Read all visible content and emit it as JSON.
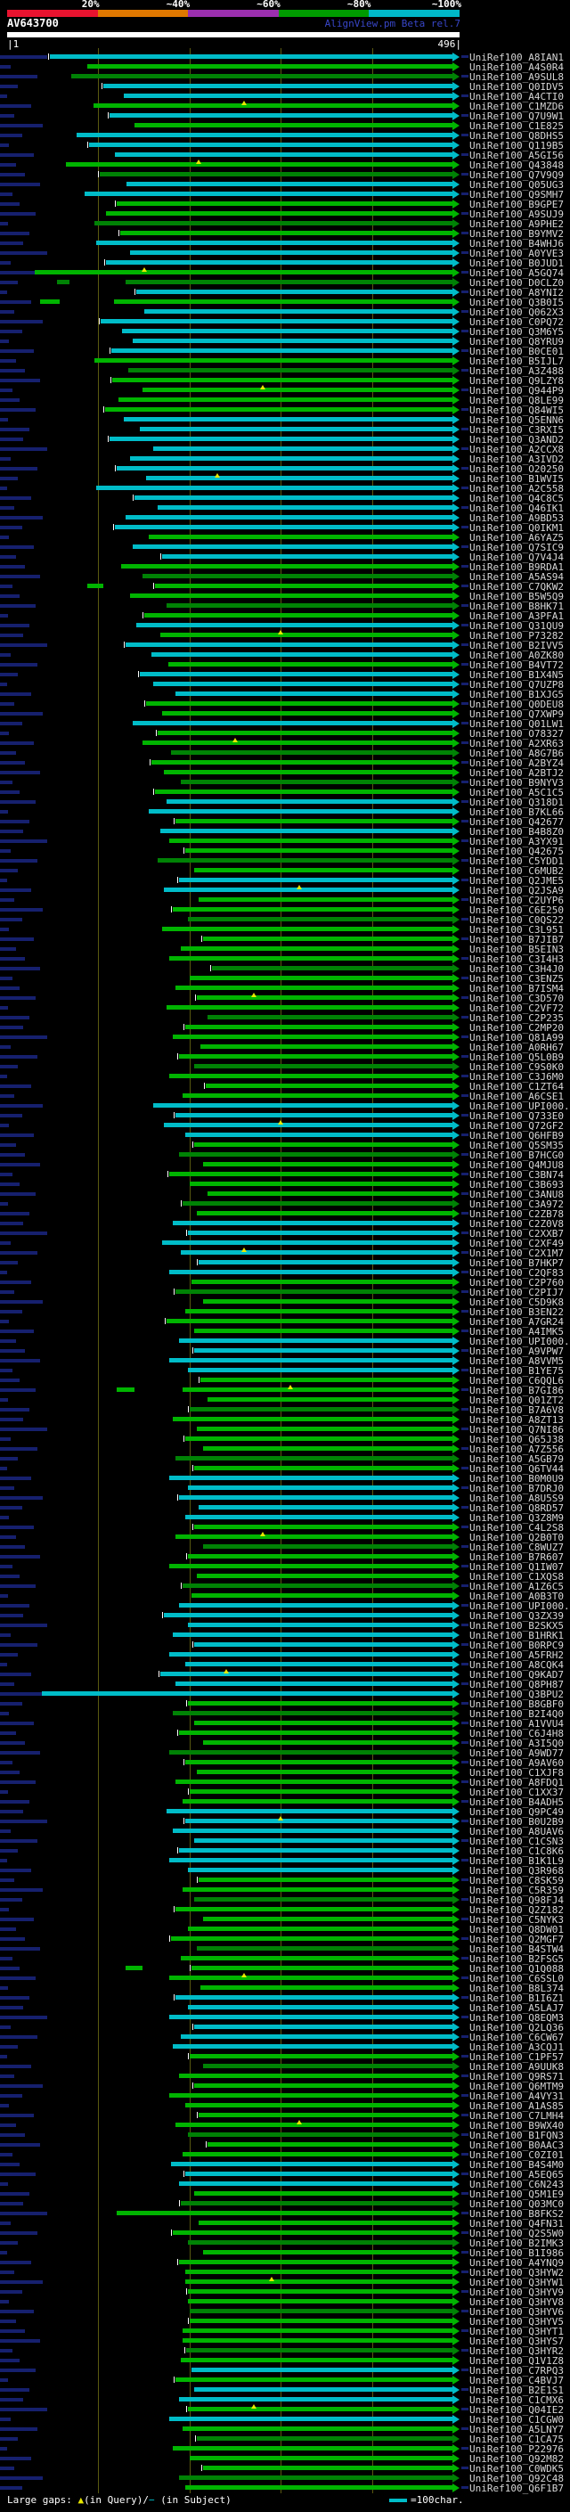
{
  "header": {
    "scale_labels": [
      "20%",
      "~40%",
      "~60%",
      "~80%",
      "~100%"
    ],
    "scale_colors": [
      "#e8132f",
      "#e07800",
      "#9b2fae",
      "#009c00",
      "#00b7c8"
    ],
    "query_id": "AV643700",
    "app_name": "AlignView.pm Beta rel.7",
    "ruler_start_label": "|1",
    "ruler_end_label": "496|",
    "query_length": 496,
    "tick_positions": [
      100,
      200,
      300,
      400
    ]
  },
  "footer": {
    "label": "Large gaps: ",
    "tri_glyph": "▲",
    "query_text": "(in Query)/",
    "dash_glyph": "−",
    "subject_text": " (in Subject)",
    "scale_note": "=100char."
  },
  "bar_colors": {
    "c": "#00bcc8",
    "g": "#00b400",
    "d": "#008205",
    "navy": "#16206e"
  },
  "label_prefix": "UniRef100_",
  "decor": {
    "lead_pattern": [
      53,
      12,
      42,
      20,
      8,
      35,
      16,
      48,
      25,
      10,
      38,
      18,
      28,
      45,
      14,
      22,
      40,
      9,
      33,
      26
    ],
    "stub_every": 2,
    "tick_every": 3
  },
  "rows": [
    [
      "A8IAN1",
      "c",
      47,
      0,
      0
    ],
    [
      "A4S0R4",
      "g",
      88,
      0,
      0
    ],
    [
      "A9SUL8",
      "d",
      70,
      0,
      0
    ],
    [
      "Q0IDV5",
      "c",
      105,
      0,
      0
    ],
    [
      "A4CTI0",
      "c",
      128,
      0,
      0
    ],
    [
      "C1MZD6",
      "g",
      95,
      260,
      0
    ],
    [
      "Q7U9W1",
      "c",
      112,
      0,
      0
    ],
    [
      "C1E825",
      "g",
      140,
      0,
      0
    ],
    [
      "Q8DHS5",
      "c",
      76,
      0,
      0
    ],
    [
      "Q119B5",
      "c",
      90,
      0,
      0
    ],
    [
      "A5GI56",
      "c",
      118,
      0,
      0
    ],
    [
      "Q43848",
      "g",
      64,
      210,
      0
    ],
    [
      "Q7V9Q9",
      "d",
      102,
      0,
      0
    ],
    [
      "Q05UG3",
      "c",
      131,
      0,
      0
    ],
    [
      "Q9SMH7",
      "c",
      85,
      0,
      0
    ],
    [
      "B9GPE7",
      "g",
      120,
      0,
      0
    ],
    [
      "A9SUJ9",
      "g",
      108,
      0,
      0
    ],
    [
      "A9PHE2",
      "d",
      96,
      0,
      0
    ],
    [
      "B9YMV2",
      "g",
      124,
      0,
      0
    ],
    [
      "B4WHJ6",
      "c",
      98,
      0,
      0
    ],
    [
      "A0YVE3",
      "c",
      135,
      0,
      0
    ],
    [
      "B0JUD1",
      "c",
      108,
      0,
      0
    ],
    [
      "A5GQ74",
      "g",
      30,
      150,
      0
    ],
    [
      "D0CLZ0",
      "d",
      130,
      0,
      [
        55,
        68
      ]
    ],
    [
      "A8YNI2",
      "c",
      142,
      0,
      0
    ],
    [
      "Q3B0I5",
      "g",
      117,
      0,
      [
        36,
        58
      ]
    ],
    [
      "Q062X3",
      "c",
      150,
      0,
      0
    ],
    [
      "C0PQ72",
      "c",
      103,
      0,
      0
    ],
    [
      "Q3M6Y5",
      "c",
      126,
      0,
      0
    ],
    [
      "Q8YRU9",
      "c",
      138,
      0,
      0
    ],
    [
      "B0CE01",
      "c",
      114,
      0,
      0
    ],
    [
      "B5IJL7",
      "g",
      96,
      0,
      0
    ],
    [
      "A3Z488",
      "d",
      133,
      0,
      0
    ],
    [
      "Q9LZY8",
      "g",
      115,
      0,
      0
    ],
    [
      "Q944P9",
      "g",
      148,
      280,
      0
    ],
    [
      "Q8LE99",
      "g",
      122,
      0,
      0
    ],
    [
      "Q84WI5",
      "g",
      107,
      0,
      0
    ],
    [
      "Q5ENN6",
      "c",
      128,
      0,
      0
    ],
    [
      "C3RXI5",
      "c",
      145,
      0,
      0
    ],
    [
      "Q3AND2",
      "c",
      112,
      0,
      0
    ],
    [
      "A2CCX8",
      "c",
      160,
      0,
      0
    ],
    [
      "A3IVD2",
      "c",
      135,
      0,
      0
    ],
    [
      "O20250",
      "c",
      120,
      0,
      0
    ],
    [
      "B1WVI5",
      "c",
      152,
      230,
      0
    ],
    [
      "A2C558",
      "c",
      98,
      0,
      0
    ],
    [
      "Q4C8C5",
      "c",
      140,
      0,
      0
    ],
    [
      "Q46IK1",
      "c",
      165,
      0,
      0
    ],
    [
      "A9BD53",
      "c",
      130,
      0,
      0
    ],
    [
      "Q0IKM1",
      "c",
      118,
      0,
      0
    ],
    [
      "A6YAZ5",
      "g",
      155,
      0,
      0
    ],
    [
      "Q7SIC9",
      "c",
      138,
      0,
      0
    ],
    [
      "Q7V4J4",
      "c",
      170,
      0,
      0
    ],
    [
      "B9RDA1",
      "g",
      125,
      0,
      0
    ],
    [
      "A5AS94",
      "d",
      148,
      0,
      0
    ],
    [
      "C7QKW2",
      "g",
      162,
      0,
      [
        88,
        105
      ]
    ],
    [
      "B5W5Q9",
      "g",
      135,
      0,
      0
    ],
    [
      "B8HK71",
      "d",
      175,
      0,
      0
    ],
    [
      "A3PFA1",
      "g",
      150,
      0,
      0
    ],
    [
      "Q31QU9",
      "c",
      142,
      0,
      0
    ],
    [
      "P73282",
      "g",
      168,
      300,
      0
    ],
    [
      "B2IVV5",
      "c",
      130,
      0,
      0
    ],
    [
      "A0ZK80",
      "c",
      158,
      0,
      0
    ],
    [
      "B4VT72",
      "g",
      177,
      0,
      0
    ],
    [
      "B1X4N5",
      "c",
      145,
      0,
      0
    ],
    [
      "Q7UZP8",
      "c",
      160,
      0,
      0
    ],
    [
      "B1XJG5",
      "c",
      185,
      0,
      0
    ],
    [
      "Q0DEU8",
      "g",
      152,
      0,
      0
    ],
    [
      "Q7XWP9",
      "g",
      170,
      0,
      0
    ],
    [
      "Q01LW1",
      "c",
      138,
      0,
      0
    ],
    [
      "O78327",
      "g",
      165,
      0,
      0
    ],
    [
      "A2XR63",
      "g",
      148,
      250,
      0
    ],
    [
      "A8G7B6",
      "d",
      180,
      0,
      0
    ],
    [
      "A2BYZ4",
      "g",
      158,
      0,
      0
    ],
    [
      "A2BTJ2",
      "g",
      172,
      0,
      0
    ],
    [
      "B9NYV3",
      "d",
      190,
      0,
      0
    ],
    [
      "A5C1C5",
      "g",
      162,
      0,
      0
    ],
    [
      "Q318D1",
      "c",
      175,
      0,
      0
    ],
    [
      "B7KL66",
      "c",
      155,
      0,
      0
    ],
    [
      "Q42677",
      "g",
      185,
      0,
      0
    ],
    [
      "B4B8Z0",
      "c",
      168,
      0,
      0
    ],
    [
      "A3YX91",
      "g",
      178,
      0,
      0
    ],
    [
      "Q42675",
      "g",
      195,
      0,
      0
    ],
    [
      "C5YDD1",
      "d",
      165,
      0,
      0
    ],
    [
      "C6MUB2",
      "g",
      205,
      0,
      0
    ],
    [
      "Q2JME5",
      "c",
      188,
      0,
      0
    ],
    [
      "Q2JSA9",
      "c",
      172,
      320,
      0
    ],
    [
      "C2UYP6",
      "g",
      210,
      0,
      0
    ],
    [
      "C6E250",
      "g",
      182,
      0,
      0
    ],
    [
      "C0QS22",
      "d",
      198,
      0,
      0
    ],
    [
      "C3L951",
      "g",
      170,
      0,
      0
    ],
    [
      "B7JIB7",
      "g",
      215,
      0,
      0
    ],
    [
      "B5EIN3",
      "g",
      190,
      0,
      0
    ],
    [
      "C3I4H3",
      "g",
      178,
      0,
      0
    ],
    [
      "C3H4J0",
      "d",
      225,
      0,
      0
    ],
    [
      "C3ENZ5",
      "g",
      200,
      0,
      0
    ],
    [
      "B7ISM4",
      "g",
      185,
      0,
      0
    ],
    [
      "C3D570",
      "g",
      208,
      270,
      0
    ],
    [
      "C2VF72",
      "g",
      175,
      0,
      0
    ],
    [
      "C2P235",
      "d",
      220,
      0,
      0
    ],
    [
      "C2MP20",
      "g",
      195,
      0,
      0
    ],
    [
      "Q81A99",
      "g",
      182,
      0,
      0
    ],
    [
      "A0RH67",
      "g",
      212,
      0,
      0
    ],
    [
      "Q5L0B9",
      "g",
      188,
      0,
      0
    ],
    [
      "C9S0K0",
      "d",
      205,
      0,
      0
    ],
    [
      "C3J6M0",
      "g",
      178,
      0,
      0
    ],
    [
      "C1ZT64",
      "g",
      218,
      0,
      0
    ],
    [
      "A6CSE1",
      "g",
      192,
      0,
      0
    ],
    [
      "UPI000..",
      "c",
      160,
      0,
      0
    ],
    [
      "Q733E0",
      "c",
      185,
      0,
      0
    ],
    [
      "Q72GF2",
      "c",
      172,
      300,
      0
    ],
    [
      "Q6HFB9",
      "c",
      195,
      0,
      0
    ],
    [
      "Q5SM35",
      "g",
      205,
      0,
      0
    ],
    [
      "B7HCG0",
      "d",
      188,
      0,
      0
    ],
    [
      "Q4MJU8",
      "g",
      215,
      0,
      0
    ],
    [
      "C3BN74",
      "g",
      178,
      0,
      0
    ],
    [
      "C3B693",
      "g",
      200,
      0,
      0
    ],
    [
      "C3ANU8",
      "g",
      220,
      0,
      0
    ],
    [
      "C3A972",
      "d",
      192,
      0,
      0
    ],
    [
      "C2ZB78",
      "g",
      208,
      0,
      0
    ],
    [
      "C2Z0V8",
      "c",
      182,
      0,
      0
    ],
    [
      "C2XXB7",
      "c",
      198,
      0,
      0
    ],
    [
      "C2XF49",
      "c",
      170,
      0,
      0
    ],
    [
      "C2X1M7",
      "c",
      190,
      260,
      0
    ],
    [
      "B7HKP7",
      "c",
      210,
      0,
      0
    ],
    [
      "C2QF83",
      "c",
      178,
      0,
      0
    ],
    [
      "C2P760",
      "g",
      202,
      0,
      0
    ],
    [
      "C2PIJ7",
      "d",
      185,
      0,
      0
    ],
    [
      "C5D9K8",
      "g",
      215,
      0,
      0
    ],
    [
      "B3EN22",
      "g",
      195,
      0,
      0
    ],
    [
      "A7GR24",
      "g",
      175,
      0,
      0
    ],
    [
      "A4IMK5",
      "g",
      205,
      0,
      0
    ],
    [
      "UPI000..",
      "c",
      188,
      0,
      0
    ],
    [
      "A9VPW7",
      "c",
      205,
      0,
      0
    ],
    [
      "A8VVM5",
      "c",
      178,
      0,
      0
    ],
    [
      "B1YE75",
      "c",
      198,
      0,
      0
    ],
    [
      "C6QQL6",
      "g",
      212,
      0,
      0
    ],
    [
      "B7GI86",
      "g",
      192,
      310,
      [
        120,
        140
      ]
    ],
    [
      "Q01ZT2",
      "g",
      220,
      0,
      0
    ],
    [
      "B7A6V8",
      "d",
      200,
      0,
      0
    ],
    [
      "A8ZT13",
      "g",
      182,
      0,
      0
    ],
    [
      "Q7NI86",
      "g",
      208,
      0,
      0
    ],
    [
      "Q65J38",
      "g",
      195,
      0,
      0
    ],
    [
      "A7Z556",
      "g",
      215,
      0,
      0
    ],
    [
      "A5GB79",
      "d",
      185,
      0,
      0
    ],
    [
      "Q6TV44",
      "g",
      205,
      0,
      0
    ],
    [
      "B0M0U9",
      "c",
      178,
      0,
      0
    ],
    [
      "B7DRJ0",
      "c",
      198,
      0,
      0
    ],
    [
      "A8U5S9",
      "c",
      188,
      0,
      0
    ],
    [
      "Q8RD57",
      "c",
      210,
      0,
      0
    ],
    [
      "Q3Z8M9",
      "c",
      195,
      0,
      0
    ],
    [
      "C4L2S8",
      "g",
      205,
      0,
      0
    ],
    [
      "Q2B0T0",
      "g",
      185,
      280,
      0
    ],
    [
      "C8WUZ7",
      "d",
      215,
      0,
      0
    ],
    [
      "B7R607",
      "g",
      198,
      0,
      0
    ],
    [
      "Q1IW07",
      "g",
      178,
      0,
      0
    ],
    [
      "C1XQS8",
      "g",
      208,
      0,
      0
    ],
    [
      "A1Z6C5",
      "d",
      192,
      0,
      0
    ],
    [
      "A0B3T0",
      "g",
      202,
      0,
      0
    ],
    [
      "UPI000..",
      "c",
      188,
      0,
      0
    ],
    [
      "Q3ZX39",
      "c",
      172,
      0,
      0
    ],
    [
      "B2SKX5",
      "c",
      198,
      0,
      0
    ],
    [
      "B1HRK1",
      "c",
      182,
      0,
      0
    ],
    [
      "B0RPC9",
      "c",
      205,
      0,
      0
    ],
    [
      "A5FRH2",
      "c",
      178,
      0,
      0
    ],
    [
      "A8CQK4",
      "c",
      195,
      0,
      0
    ],
    [
      "Q9KAD7",
      "c",
      168,
      240,
      0
    ],
    [
      "Q8PH87",
      "c",
      185,
      0,
      0
    ],
    [
      "Q3BPU2",
      "c",
      38,
      0,
      0
    ],
    [
      "B8GBF0",
      "g",
      198,
      0,
      0
    ],
    [
      "B2I4Q0",
      "d",
      182,
      0,
      0
    ],
    [
      "A1VVU4",
      "g",
      205,
      0,
      0
    ],
    [
      "C6J4H8",
      "g",
      188,
      0,
      0
    ],
    [
      "A3I5Q0",
      "g",
      215,
      0,
      0
    ],
    [
      "A9WD77",
      "d",
      178,
      0,
      0
    ],
    [
      "A9AV60",
      "g",
      195,
      0,
      0
    ],
    [
      "C1XJF8",
      "g",
      208,
      0,
      0
    ],
    [
      "A8FDQ1",
      "g",
      185,
      0,
      0
    ],
    [
      "C1XX37",
      "g",
      200,
      0,
      0
    ],
    [
      "B4ADH5",
      "g",
      192,
      0,
      0
    ],
    [
      "Q9PC49",
      "c",
      175,
      0,
      0
    ],
    [
      "B0U2B9",
      "c",
      195,
      300,
      0
    ],
    [
      "A8UAV6",
      "c",
      182,
      0,
      0
    ],
    [
      "C1CSN3",
      "c",
      205,
      0,
      0
    ],
    [
      "C1C8K6",
      "c",
      188,
      0,
      0
    ],
    [
      "B1K1L9",
      "c",
      178,
      0,
      0
    ],
    [
      "Q3R968",
      "c",
      198,
      0,
      0
    ],
    [
      "C8SK59",
      "g",
      210,
      0,
      0
    ],
    [
      "C5R359",
      "g",
      192,
      0,
      0
    ],
    [
      "Q98FJ4",
      "d",
      205,
      0,
      0
    ],
    [
      "Q2Z182",
      "g",
      185,
      0,
      0
    ],
    [
      "C5NYK3",
      "g",
      215,
      0,
      0
    ],
    [
      "Q8DW01",
      "g",
      198,
      0,
      0
    ],
    [
      "Q2MGF7",
      "g",
      180,
      0,
      0
    ],
    [
      "B4STW4",
      "d",
      208,
      0,
      0
    ],
    [
      "B2FSG5",
      "g",
      190,
      0,
      0
    ],
    [
      "Q1Q088",
      "g",
      202,
      0,
      [
        130,
        148
      ]
    ],
    [
      "C6SSL0",
      "g",
      178,
      260,
      0
    ],
    [
      "B8L374",
      "g",
      212,
      0,
      0
    ],
    [
      "B1I6Z1",
      "c",
      185,
      0,
      0
    ],
    [
      "A5LAJ7",
      "c",
      198,
      0,
      0
    ],
    [
      "Q8EQM3",
      "c",
      178,
      0,
      0
    ],
    [
      "Q2LQ36",
      "c",
      205,
      0,
      0
    ],
    [
      "C6CW67",
      "c",
      190,
      0,
      0
    ],
    [
      "A3CQJ1",
      "c",
      182,
      0,
      0
    ],
    [
      "C1PF57",
      "g",
      200,
      0,
      0
    ],
    [
      "A9UUK8",
      "d",
      215,
      0,
      0
    ],
    [
      "Q9RS71",
      "g",
      188,
      0,
      0
    ],
    [
      "Q6MTM9",
      "g",
      205,
      0,
      0
    ],
    [
      "A4VY31",
      "g",
      178,
      0,
      0
    ],
    [
      "A1AS85",
      "g",
      195,
      0,
      0
    ],
    [
      "C7LMH4",
      "g",
      210,
      0,
      0
    ],
    [
      "B9WX40",
      "g",
      185,
      320,
      0
    ],
    [
      "B1FQN3",
      "d",
      198,
      0,
      0
    ],
    [
      "B0AAC3",
      "g",
      220,
      0,
      0
    ],
    [
      "C0ZI01",
      "g",
      192,
      0,
      0
    ],
    [
      "B4S4M0",
      "c",
      180,
      0,
      0
    ],
    [
      "A5EQ65",
      "c",
      195,
      0,
      0
    ],
    [
      "C6N243",
      "c",
      188,
      0,
      0
    ],
    [
      "Q5M1E9",
      "g",
      205,
      0,
      0
    ],
    [
      "Q03MC0",
      "d",
      190,
      0,
      0
    ],
    [
      "B8FKS2",
      "g",
      120,
      0,
      0
    ],
    [
      "Q4FN31",
      "g",
      210,
      0,
      0
    ],
    [
      "Q2S5W0",
      "g",
      182,
      0,
      0
    ],
    [
      "B2IMK3",
      "d",
      198,
      0,
      0
    ],
    [
      "B1I986",
      "g",
      215,
      0,
      0
    ],
    [
      "A4YNQ9",
      "g",
      188,
      0,
      0
    ],
    [
      "Q3HYW2",
      "g",
      195,
      0,
      0
    ],
    [
      "Q3HYW1",
      "g",
      195,
      290,
      0
    ],
    [
      "Q3HYV9",
      "g",
      198,
      0,
      0
    ],
    [
      "Q3HYV8",
      "g",
      198,
      0,
      0
    ],
    [
      "Q3HYV6",
      "d",
      200,
      0,
      0
    ],
    [
      "Q3HYV5",
      "g",
      200,
      0,
      0
    ],
    [
      "Q3HYT1",
      "g",
      192,
      0,
      0
    ],
    [
      "Q3HYS7",
      "g",
      192,
      0,
      0
    ],
    [
      "Q3HYR2",
      "d",
      196,
      0,
      0
    ],
    [
      "Q1V1Z8",
      "g",
      190,
      0,
      0
    ],
    [
      "C7RPQ3",
      "c",
      202,
      0,
      0
    ],
    [
      "C4BVJ7",
      "g",
      185,
      0,
      0
    ],
    [
      "B2E1S1",
      "c",
      205,
      0,
      0
    ],
    [
      "C1CMX6",
      "c",
      188,
      0,
      0
    ],
    [
      "Q04IE2",
      "g",
      198,
      270,
      0
    ],
    [
      "C1CGW0",
      "c",
      178,
      0,
      0
    ],
    [
      "A5LNY7",
      "g",
      192,
      0,
      0
    ],
    [
      "C1CA75",
      "d",
      208,
      0,
      0
    ],
    [
      "P22976",
      "g",
      182,
      0,
      0
    ],
    [
      "Q92M82",
      "g",
      200,
      0,
      0
    ],
    [
      "C0WDK5",
      "g",
      215,
      0,
      0
    ],
    [
      "Q92C48",
      "d",
      188,
      0,
      0
    ],
    [
      "Q6F1B7",
      "g",
      195,
      0,
      0
    ]
  ]
}
